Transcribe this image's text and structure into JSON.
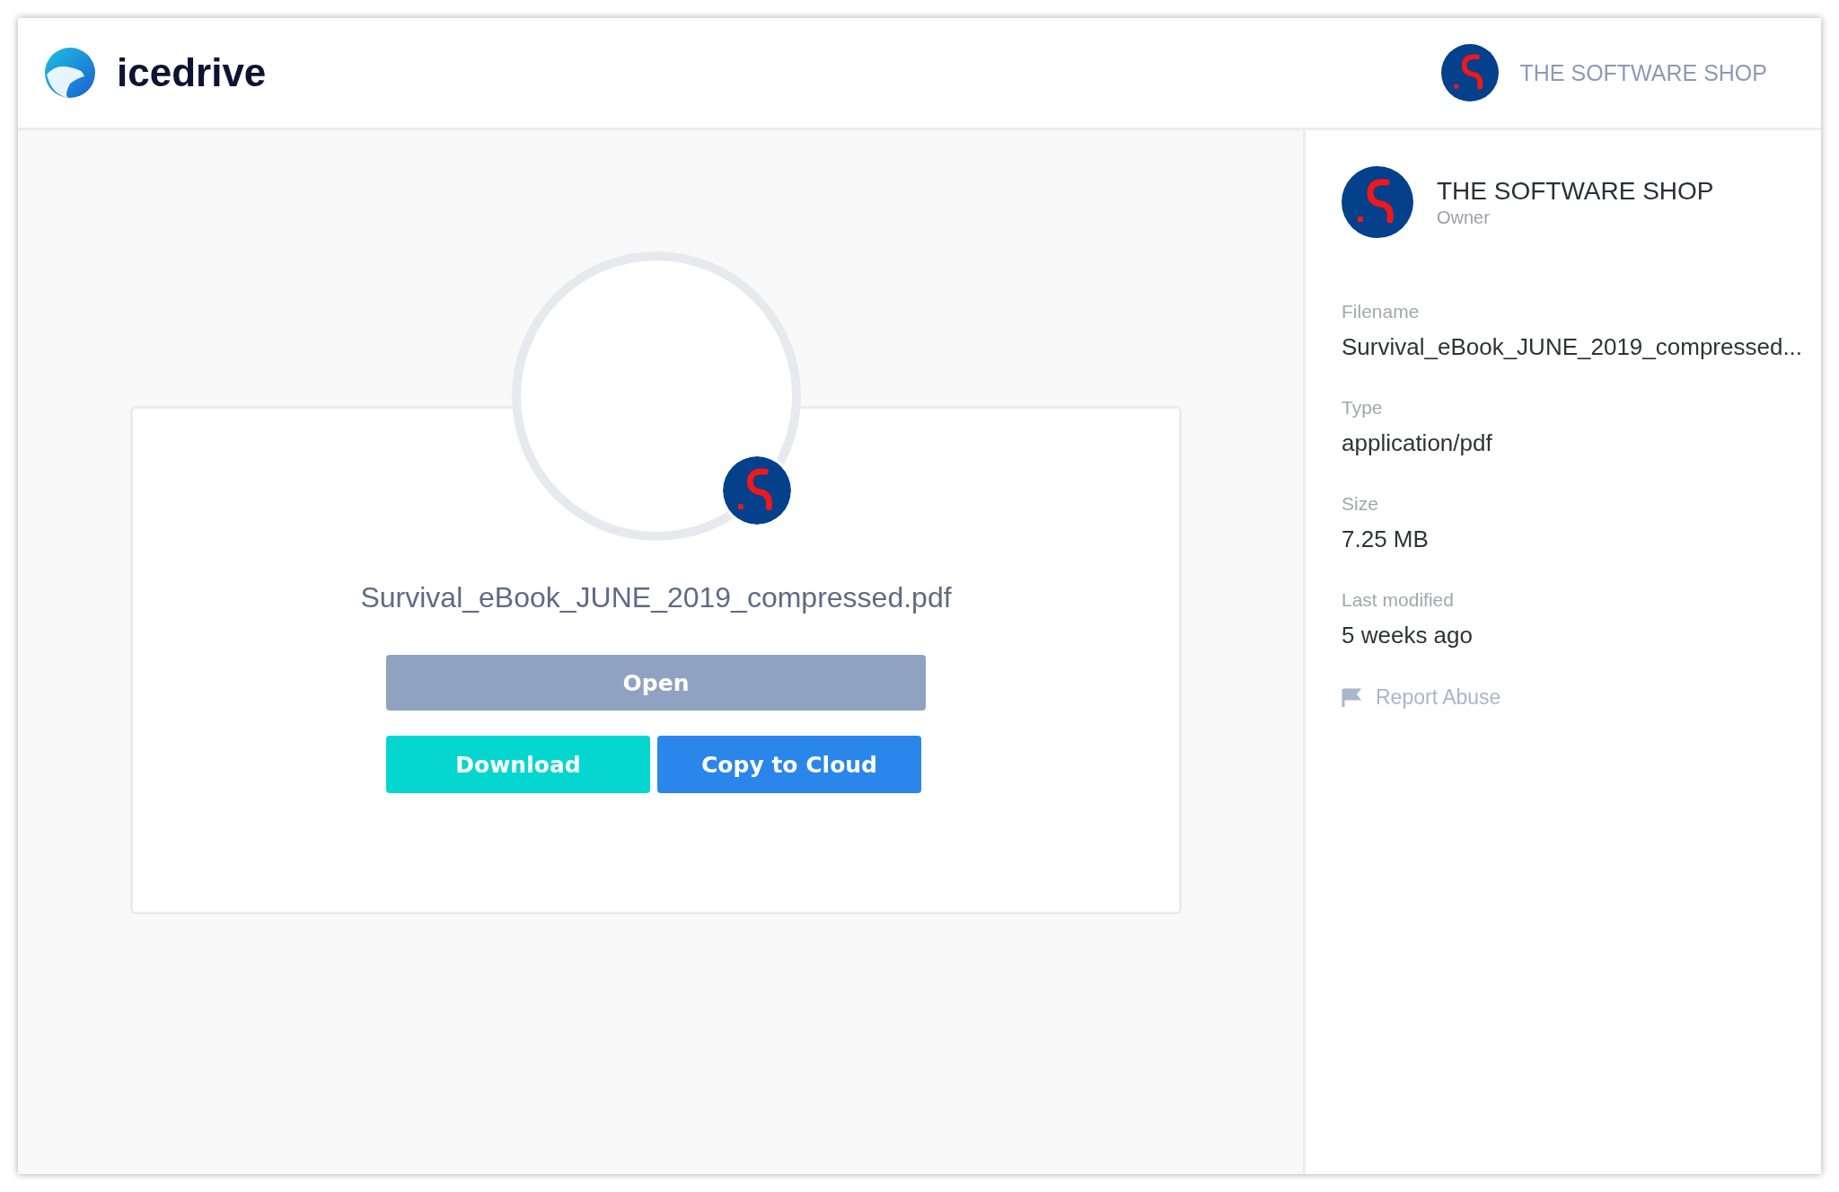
{
  "header": {
    "logo": "icedrive",
    "account": "THE SOFTWARE SHOP"
  },
  "preview": {
    "filename": "Survival_eBook_JUNE_2019_compressed.pdf",
    "buttons": [
      {
        "label": "Open",
        "kind": "open"
      },
      {
        "label": "Download",
        "kind": "download"
      },
      {
        "label": "Copy to Cloud",
        "kind": "copy"
      }
    ]
  },
  "sidebar": {
    "owner": "THE SOFTWARE SHOP",
    "role": "Owner",
    "details": [
      {
        "label": "Filename",
        "value": "Survival_eBook_JUNE_2019_compressed..."
      },
      {
        "label": "Type",
        "value": "application/pdf"
      },
      {
        "label": "Size",
        "value": "7.25 MB"
      },
      {
        "label": "Last modified",
        "value": "5 weeks ago"
      }
    ],
    "report": "Report Abuse"
  }
}
